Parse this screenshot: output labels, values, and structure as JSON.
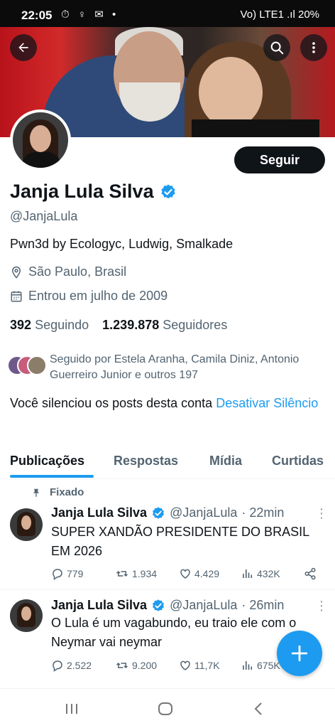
{
  "status_bar": {
    "time": "22:05",
    "left_icons": "⏱ ♀ ✉ •",
    "right_text": "Vo) LTE1 .ıl 20%"
  },
  "profile": {
    "name": "Janja Lula Silva",
    "handle": "@JanjaLula",
    "bio": "Pwn3d by Ecologyc, Ludwig, Smalkade",
    "location": "São Paulo, Brasil",
    "joined": "Entrou em julho de 2009",
    "following_count": "392",
    "following_label": "Seguindo",
    "followers_count": "1.239.878",
    "followers_label": "Seguidores",
    "followed_by": "Seguido por Estela Aranha, Camila Diniz, Antonio Guerreiro Junior e outros 197",
    "muted_text": "Você silenciou os posts desta conta",
    "unmute_link": "Desativar Silêncio",
    "follow_label": "Seguir",
    "verified_color": "#1d9bf0"
  },
  "tabs": [
    {
      "label": "Publicações",
      "active": true
    },
    {
      "label": "Respostas",
      "active": false
    },
    {
      "label": "Mídia",
      "active": false
    },
    {
      "label": "Curtidas",
      "active": false
    }
  ],
  "pinned_label": "Fixado",
  "tweets": [
    {
      "name": "Janja Lula Silva",
      "handle": "@JanjaLula",
      "time": "· 22min",
      "text": "SUPER XANDÃO PRESIDENTE DO BRASIL EM 2026",
      "replies": "779",
      "retweets": "1.934",
      "likes": "4.429",
      "views": "432K"
    },
    {
      "name": "Janja Lula Silva",
      "handle": "@JanjaLula",
      "time": "· 26min",
      "text": "O Lula é um vagabundo, eu traio ele com o Neymar vai neymar",
      "replies": "2.522",
      "retweets": "9.200",
      "likes": "11,7K",
      "views": "675K"
    }
  ],
  "colors": {
    "accent": "#1d9bf0",
    "text": "#0f1419",
    "muted": "#536471"
  }
}
